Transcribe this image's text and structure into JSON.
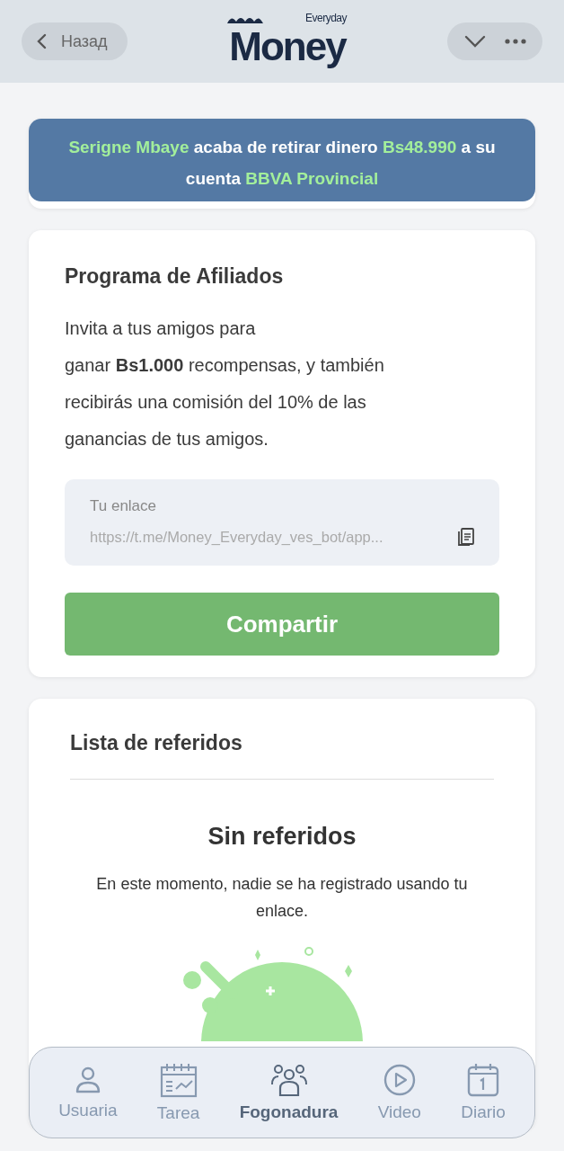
{
  "header": {
    "back_label": "Назад",
    "logo_small": "Everyday",
    "logo_main": "Money"
  },
  "notification": {
    "segments": [
      {
        "text": "Serigne Mbaye",
        "highlight": true
      },
      {
        "text": " acaba de retirar dinero ",
        "highlight": false
      },
      {
        "text": "Bs48.990",
        "highlight": true
      },
      {
        "text": " a su cuenta ",
        "highlight": false
      },
      {
        "text": "BBVA Provincial",
        "highlight": true
      }
    ]
  },
  "affiliate": {
    "title": "Programa de Afiliados",
    "text": "Invita a tus amigos para\nganar **Bs1.000** recompensas, y también recibirás una comisión del 10% de las ganancias de tus amigos.",
    "link_label": "Tu enlace",
    "link_value": "https://t.me/Money_Everyday_ves_bot/app...",
    "share_button": "Compartir"
  },
  "referrals": {
    "title": "Lista de referidos",
    "empty_title": "Sin referidos",
    "empty_text": "En este momento, nadie se ha registrado usando tu enlace."
  },
  "nav": [
    {
      "label": "Usuaria",
      "kind": "user",
      "selected": false
    },
    {
      "label": "Tarea",
      "kind": "tasks",
      "selected": false
    },
    {
      "label": "Fogonadura",
      "kind": "group",
      "selected": true
    },
    {
      "label": "Video",
      "kind": "play",
      "selected": false
    },
    {
      "label": "Diario",
      "kind": "calendar",
      "selected": false
    }
  ]
}
